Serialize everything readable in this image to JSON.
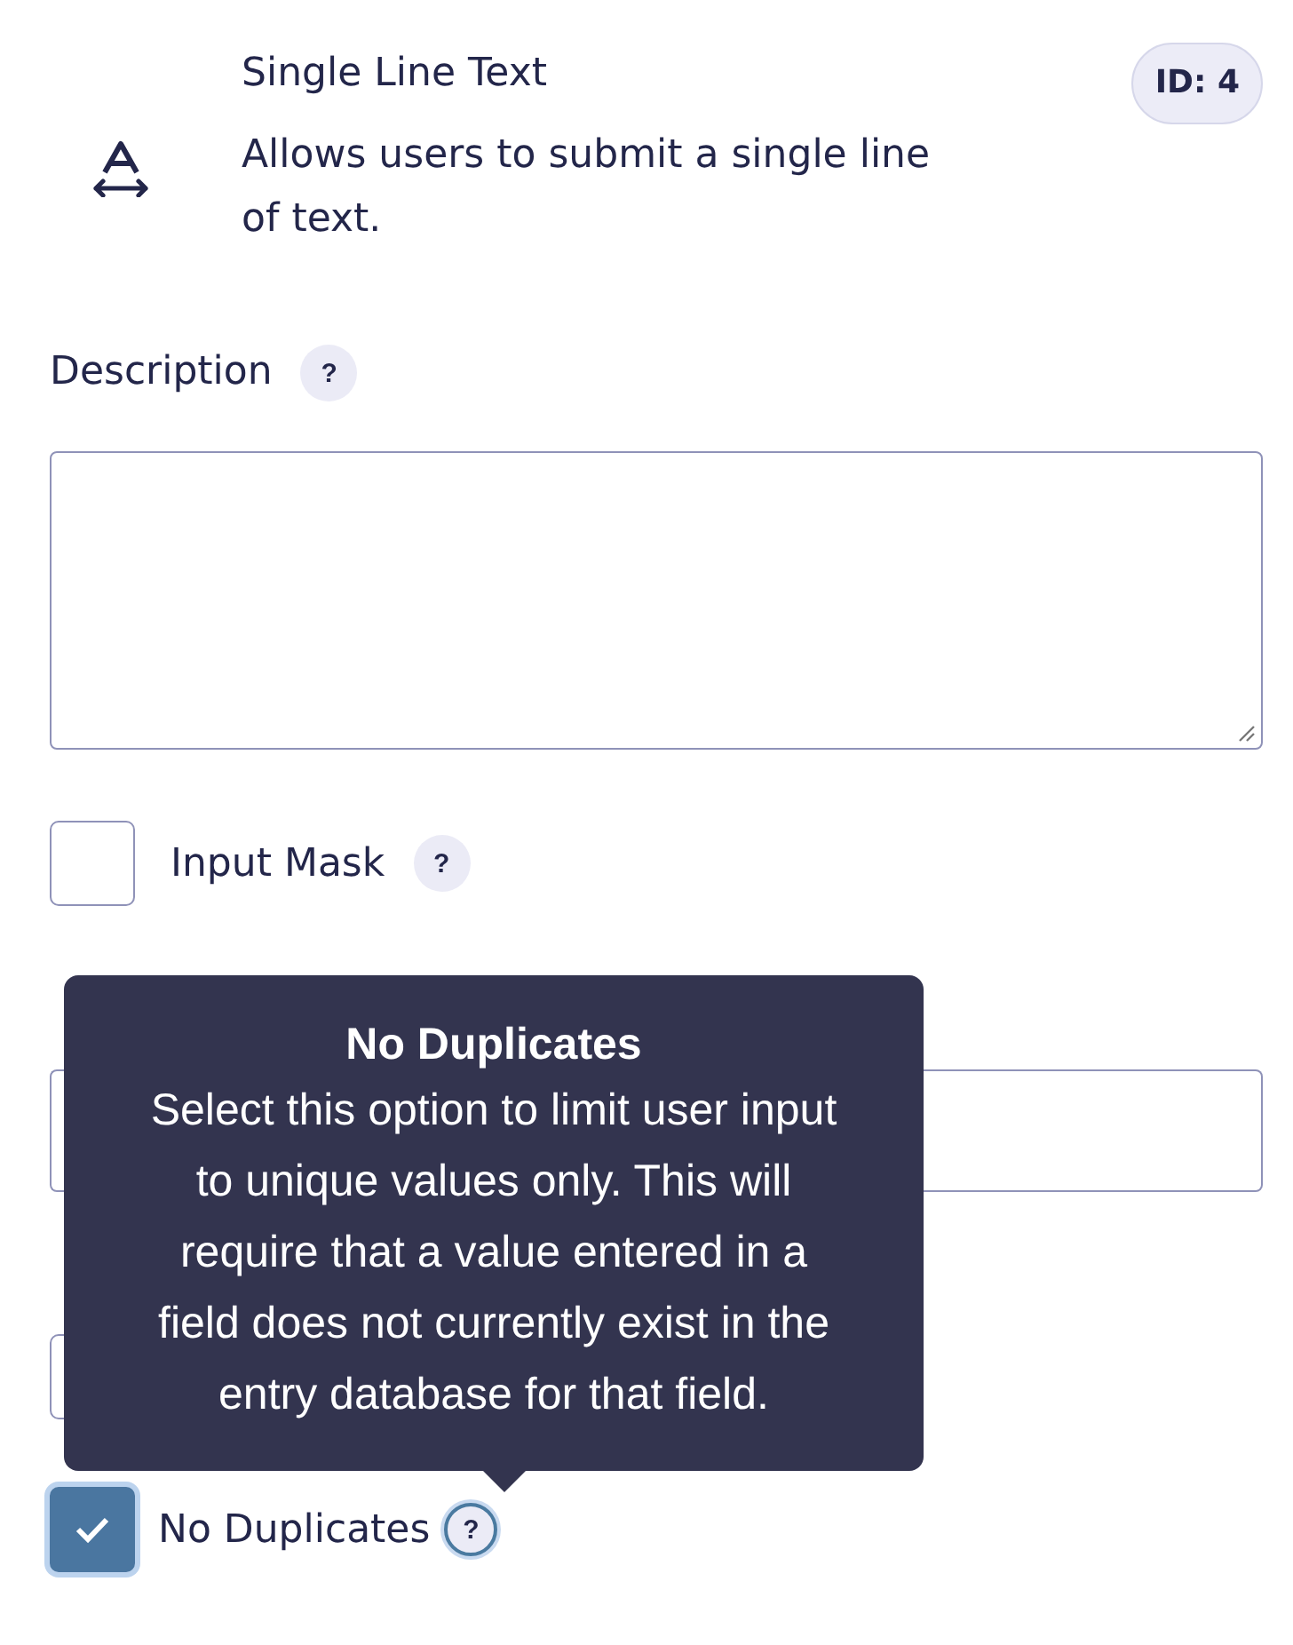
{
  "field": {
    "title": "Single Line Text",
    "description": "Allows users to submit a single line of text.",
    "id_badge": "ID: 4"
  },
  "description_setting": {
    "label": "Description",
    "help": "?"
  },
  "input_mask": {
    "label": "Input Mask",
    "checked": false,
    "help": "?"
  },
  "rules": {
    "options": [
      {
        "checked": false,
        "focused": false
      },
      {
        "label": "No Duplicates",
        "checked": true,
        "focused": true,
        "help": "?"
      }
    ]
  },
  "tooltip": {
    "title": "No Duplicates",
    "text": "Select this option to limit user input\nto unique values only. This will\nrequire that a value entered in a\nfield does not currently exist in the\nentry database for that field."
  }
}
